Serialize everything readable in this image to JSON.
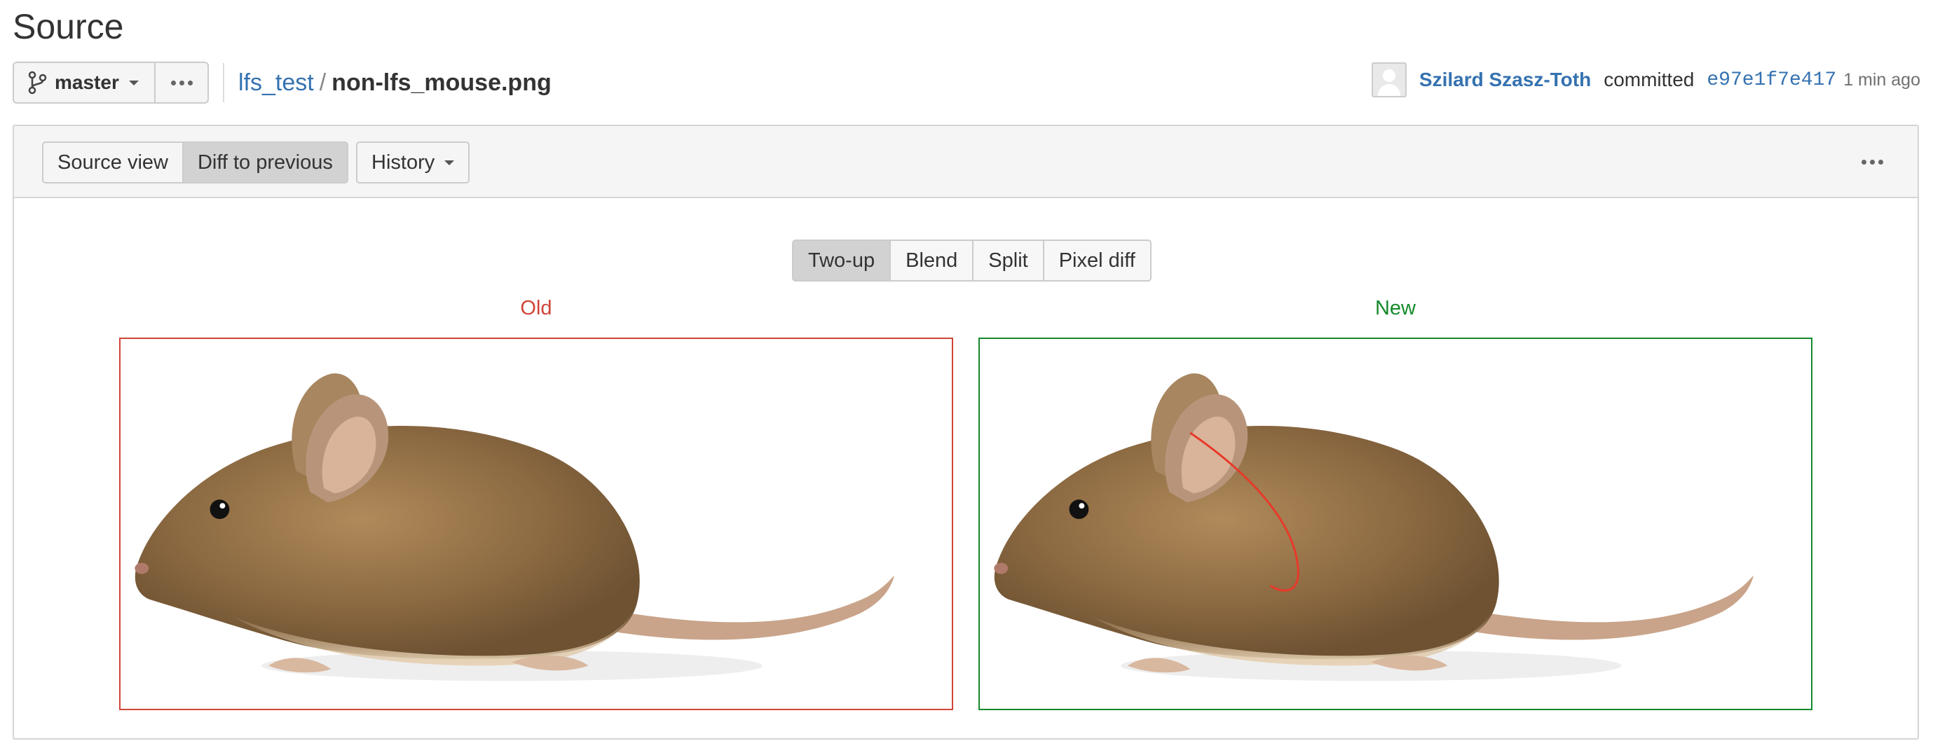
{
  "page": {
    "title": "Source"
  },
  "toolbar": {
    "branch": "master",
    "repo": "lfs_test",
    "separator": "/",
    "file": "non-lfs_mouse.png"
  },
  "commit": {
    "author": "Szilard Szasz-Toth",
    "action": "committed",
    "hash": "e97e1f7e417",
    "time": "1 min ago"
  },
  "panel": {
    "source_view": "Source view",
    "diff_to_previous": "Diff to previous",
    "active_view": "Diff to previous",
    "history": "History"
  },
  "diff_modes": {
    "items": [
      "Two-up",
      "Blend",
      "Split",
      "Pixel diff"
    ],
    "active": "Two-up"
  },
  "images": {
    "old_label": "Old",
    "new_label": "New"
  },
  "colors": {
    "link": "#3572b0",
    "old_border": "#d04437",
    "new_border": "#14892c",
    "active_button": "#d2d2d2"
  },
  "icons": [
    "branch-icon",
    "more-icon",
    "avatar-icon",
    "caret-down-icon"
  ]
}
